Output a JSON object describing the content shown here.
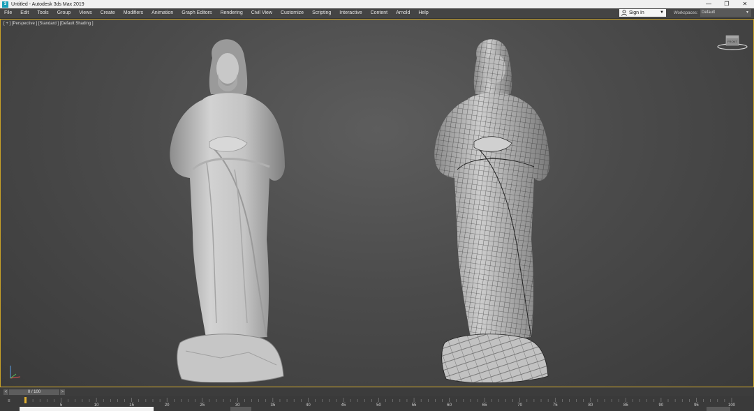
{
  "window": {
    "title": "Untitled - Autodesk 3ds Max 2019",
    "icon": "3ds-max-app-icon",
    "minimize_glyph": "—",
    "maximize_glyph": "❐",
    "close_glyph": "✕"
  },
  "menu": {
    "items": [
      "File",
      "Edit",
      "Tools",
      "Group",
      "Views",
      "Create",
      "Modifiers",
      "Animation",
      "Graph Editors",
      "Rendering",
      "Civil View",
      "Customize",
      "Scripting",
      "Interactive",
      "Content",
      "Arnold",
      "Help"
    ]
  },
  "account": {
    "signin_label": "Sign In"
  },
  "workspaces": {
    "label": "Workspaces:",
    "value": "Default"
  },
  "viewport": {
    "label": "[ + ] [Perspective ] [Standard ] [Default Shading ]",
    "objects": [
      "statue-shaded",
      "statue-wireframe"
    ]
  },
  "timeline": {
    "slider_text": "0 / 100",
    "prev_glyph": "<",
    "next_glyph": ">",
    "ticks": [
      "5",
      "10",
      "15",
      "20",
      "25",
      "30",
      "35",
      "40",
      "45",
      "50",
      "55",
      "60",
      "65",
      "70",
      "75",
      "80",
      "85",
      "90",
      "95",
      "100"
    ]
  },
  "colors": {
    "viewport_border": "#c9a227",
    "ui_dark": "#444444"
  }
}
